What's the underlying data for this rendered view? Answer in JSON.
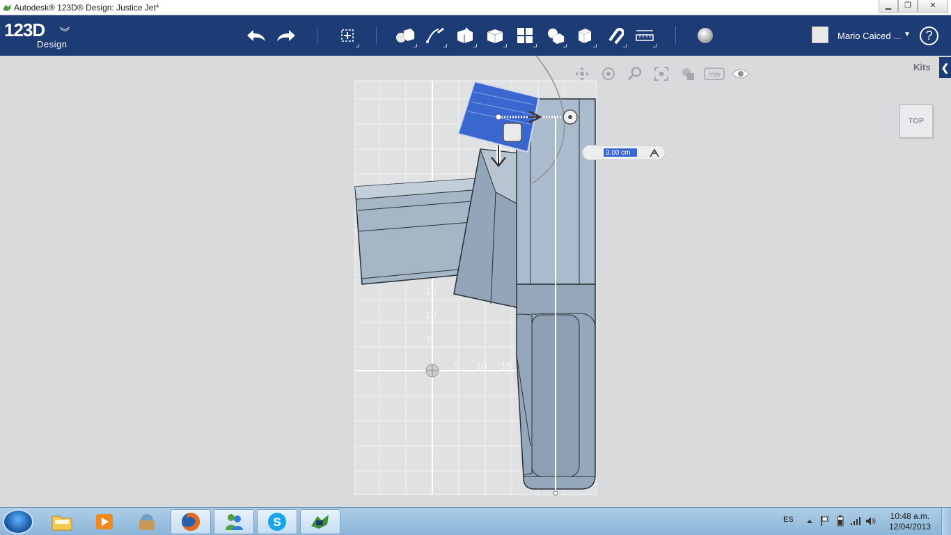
{
  "window": {
    "title": "Autodesk® 123D® Design: Justice Jet*",
    "controls": [
      "minimize",
      "maximize",
      "close"
    ]
  },
  "app": {
    "logo_main": "123D",
    "logo_sub": "Design",
    "toolbar": [
      {
        "id": "undo",
        "icon": "undo-icon"
      },
      {
        "id": "redo",
        "icon": "redo-icon"
      },
      {
        "id": "transform",
        "icon": "transform-icon"
      },
      {
        "id": "primitives",
        "icon": "primitives-icon"
      },
      {
        "id": "sketch",
        "icon": "sketch-icon"
      },
      {
        "id": "construct",
        "icon": "construct-icon"
      },
      {
        "id": "modify",
        "icon": "modify-icon"
      },
      {
        "id": "pattern",
        "icon": "pattern-icon"
      },
      {
        "id": "group",
        "icon": "group-icon"
      },
      {
        "id": "combine",
        "icon": "combine-icon"
      },
      {
        "id": "snap",
        "icon": "snap-icon"
      },
      {
        "id": "measure",
        "icon": "measure-icon"
      },
      {
        "id": "material",
        "icon": "material-icon"
      }
    ],
    "user_name": "Mario Caiced ...",
    "help_label": "?"
  },
  "viewport": {
    "kits_label": "Kits",
    "kits_tab_glyph": "❮",
    "viewcube_label": "TOP",
    "units_label": "mm",
    "nav_icons": [
      "pan-icon",
      "orbit-icon",
      "zoom-icon",
      "fit-icon",
      "visual-style-icon",
      "units-icon",
      "visibility-icon"
    ],
    "dimension_value": "3.00 cm",
    "grid_labels_y": [
      "15",
      "10",
      "5"
    ],
    "grid_labels_x": [
      "5",
      "10",
      "15"
    ],
    "colors": {
      "selected_face": "#3a67cf",
      "body": "#9fb0c1",
      "grid_line": "#f2f4f5"
    }
  },
  "taskbar": {
    "tasks": [
      {
        "name": "explorer",
        "icon": "folder-icon"
      },
      {
        "name": "media",
        "icon": "media-player-icon"
      },
      {
        "name": "app3",
        "icon": "archive-icon"
      },
      {
        "name": "firefox",
        "icon": "firefox-icon"
      },
      {
        "name": "messenger",
        "icon": "messenger-icon"
      },
      {
        "name": "skype",
        "icon": "skype-icon"
      },
      {
        "name": "123d",
        "icon": "123d-design-icon"
      }
    ],
    "language": "ES",
    "time": "10:48 a.m.",
    "date": "12/04/2013"
  }
}
